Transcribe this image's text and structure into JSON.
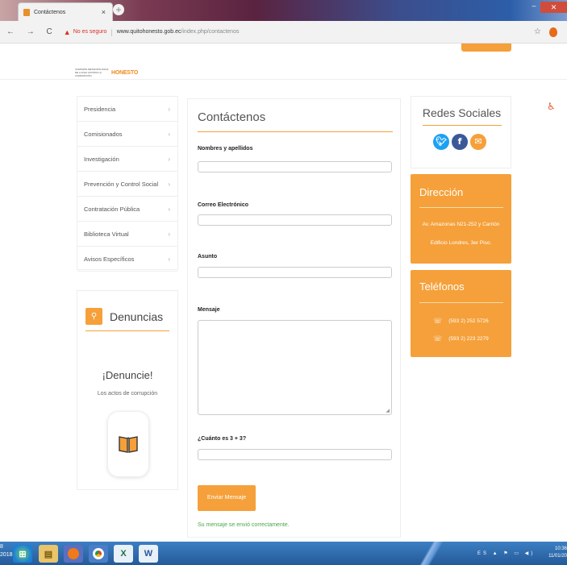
{
  "browser": {
    "tab_title": "Contáctenos",
    "tab_close": "×",
    "new_tab": "+",
    "nav_buttons": "← → C",
    "insecure_label": "No es seguro",
    "url_domain": "www.quitohonesto.gob.ec",
    "url_path": "/index.php/contactenos",
    "star": "☆"
  },
  "site": {
    "logo_text": "HONESTO",
    "logo_small": "COMISIÓN METROPOLITANA DE LUCHA CONTRA LA CORRUPCIÓN"
  },
  "sidebar": {
    "items": [
      {
        "label": "Presidencia"
      },
      {
        "label": "Comisionados"
      },
      {
        "label": "Investigación"
      },
      {
        "label": "Prevención y Control Social"
      },
      {
        "label": "Contratación Pública"
      },
      {
        "label": "Biblioteca Virtual"
      },
      {
        "label": "Avisos Específicos"
      }
    ],
    "chevron": "›"
  },
  "denuncias": {
    "title": "Denuncias",
    "headline": "¡Denuncie!",
    "subtitle": "Los actos de corrupción"
  },
  "form": {
    "title": "Contáctenos",
    "name_label": "Nombres y apellidos",
    "email_label": "Correo Electrónico",
    "subject_label": "Asunto",
    "message_label": "Mensaje",
    "captcha_label": "¿Cuánto es 3 + 3?",
    "name_value": "",
    "email_value": "",
    "subject_value": "",
    "message_value": "",
    "captcha_value": "",
    "submit_label": "Enviar Mensaje",
    "success_message": "Su mensaje se envió correctamente."
  },
  "social": {
    "title": "Redes Sociales"
  },
  "direccion": {
    "title": "Dirección",
    "line1": "Av. Amazonas N21-252 y Carrión",
    "line2": "Edificio Londres, 3er Piso."
  },
  "telefonos": {
    "title": "Teléfonos",
    "phones": [
      "(593 2) 252 5726",
      "(593 2) 223 2279"
    ]
  },
  "taskbar": {
    "clock_time": "10:36",
    "clock_date": "11/01/20",
    "left_year": "2018",
    "left_num": "8",
    "tray": "ES ▲ ⚑ ▭ ◀)"
  },
  "colors": {
    "accent": "#f5a03a",
    "success": "#49a84a",
    "twitter": "#1da1f2",
    "facebook": "#3b5998",
    "email": "#f5a03a"
  },
  "icons": [
    "search-icon",
    "book-icon",
    "twitter-icon",
    "facebook-icon",
    "email-icon",
    "phone-icon",
    "accessibility-icon"
  ]
}
